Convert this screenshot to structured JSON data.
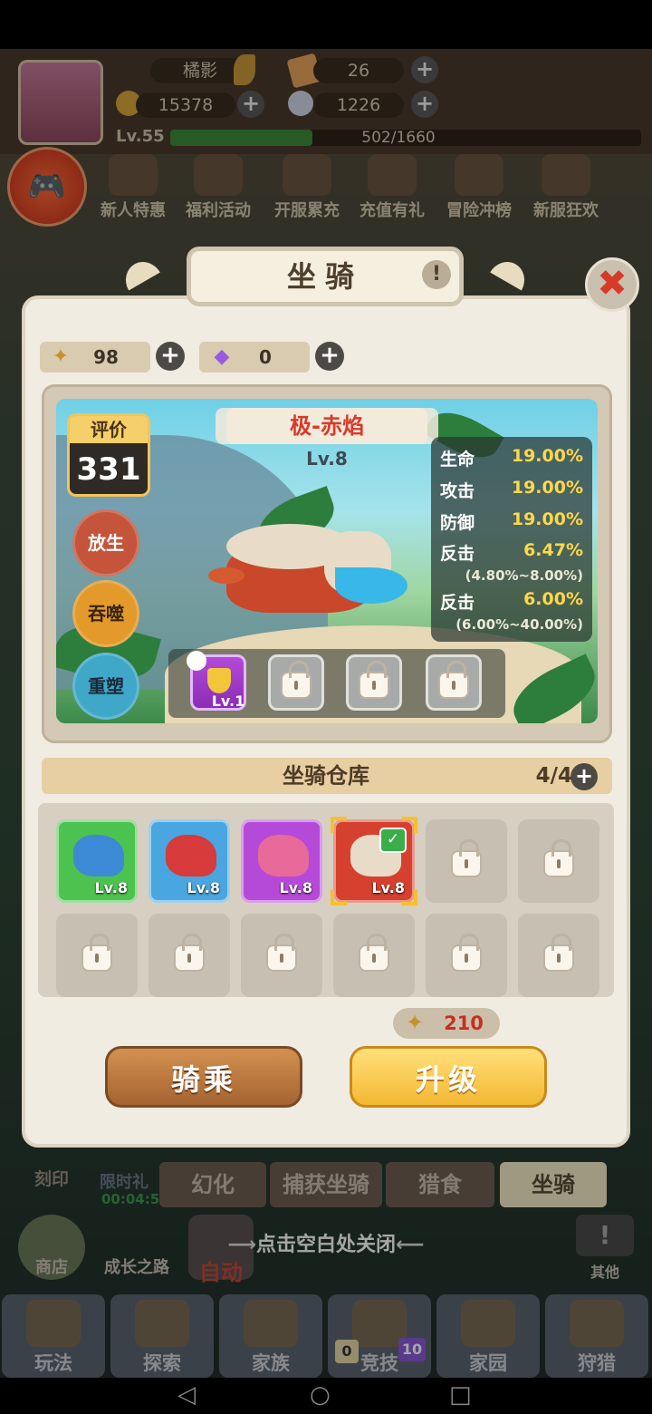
{
  "hud": {
    "player_name": "橘影",
    "tickets": "26",
    "coins": "15378",
    "shells": "1226",
    "level": "Lv.55",
    "exp": "502/1660",
    "exp_progress": 0.302
  },
  "events": [
    "新人特惠",
    "福利活动",
    "开服累充",
    "充值有礼",
    "冒险冲榜",
    "新服狂欢"
  ],
  "dialog": {
    "title": "坐骑",
    "info_glyph": "!",
    "close_glyph": "✖",
    "currencies": [
      {
        "icon": "wheat-icon",
        "value": "98"
      },
      {
        "icon": "crystal-icon",
        "value": "0"
      }
    ],
    "mount": {
      "name": "极-赤焰",
      "level": "Lv.8",
      "rating_label": "评价",
      "rating_value": "331",
      "actions": [
        "放生",
        "吞噬",
        "重塑"
      ],
      "stats": [
        {
          "name": "生命",
          "value": "19.00%"
        },
        {
          "name": "攻击",
          "value": "19.00%"
        },
        {
          "name": "防御",
          "value": "19.00%"
        },
        {
          "name": "反击",
          "value": "6.47%",
          "range": "(4.80%~8.00%)"
        },
        {
          "name": "反击",
          "value": "6.00%",
          "range": "(6.00%~40.00%)"
        }
      ],
      "equip_slots": [
        {
          "state": "filled",
          "level": "Lv.1"
        },
        {
          "state": "locked"
        },
        {
          "state": "locked"
        },
        {
          "state": "locked"
        }
      ]
    },
    "warehouse": {
      "title": "坐骑仓库",
      "count": "4/4",
      "slots": [
        {
          "state": "mount",
          "color": "#4cc34f",
          "dino": "#3c8ad6",
          "level": "Lv.8"
        },
        {
          "state": "mount",
          "color": "#4aa6e0",
          "dino": "#d63a3a",
          "level": "Lv.8"
        },
        {
          "state": "mount",
          "color": "#b64ad8",
          "dino": "#e86a9a",
          "level": "Lv.8"
        },
        {
          "state": "selected",
          "color": "#d6402e",
          "dino": "#e8dcc8",
          "level": "Lv.8"
        },
        {
          "state": "locked"
        },
        {
          "state": "locked"
        },
        {
          "state": "locked"
        },
        {
          "state": "locked"
        },
        {
          "state": "locked"
        },
        {
          "state": "locked"
        },
        {
          "state": "locked"
        },
        {
          "state": "locked"
        }
      ]
    },
    "upgrade_cost": "210",
    "ride_label": "骑乘",
    "upgrade_label": "升级"
  },
  "bottom": {
    "side_left": [
      "刻印",
      "限时礼",
      "00:04:5"
    ],
    "subtabs": [
      "幻化",
      "捕获坐骑",
      "猎食",
      "坐骑"
    ],
    "close_hint": "点击空白处关闭",
    "row2": [
      "商店",
      "成长之路",
      "自动",
      "其他"
    ],
    "nav": [
      "玩法",
      "探索",
      "家族",
      "竞技",
      "家园",
      "狩猎"
    ],
    "arena_badges": [
      "0",
      "10"
    ]
  },
  "colors": {
    "accent_red": "#d83a2a",
    "stat_yellow": "#ffd84a",
    "gold": "#f4b834"
  }
}
